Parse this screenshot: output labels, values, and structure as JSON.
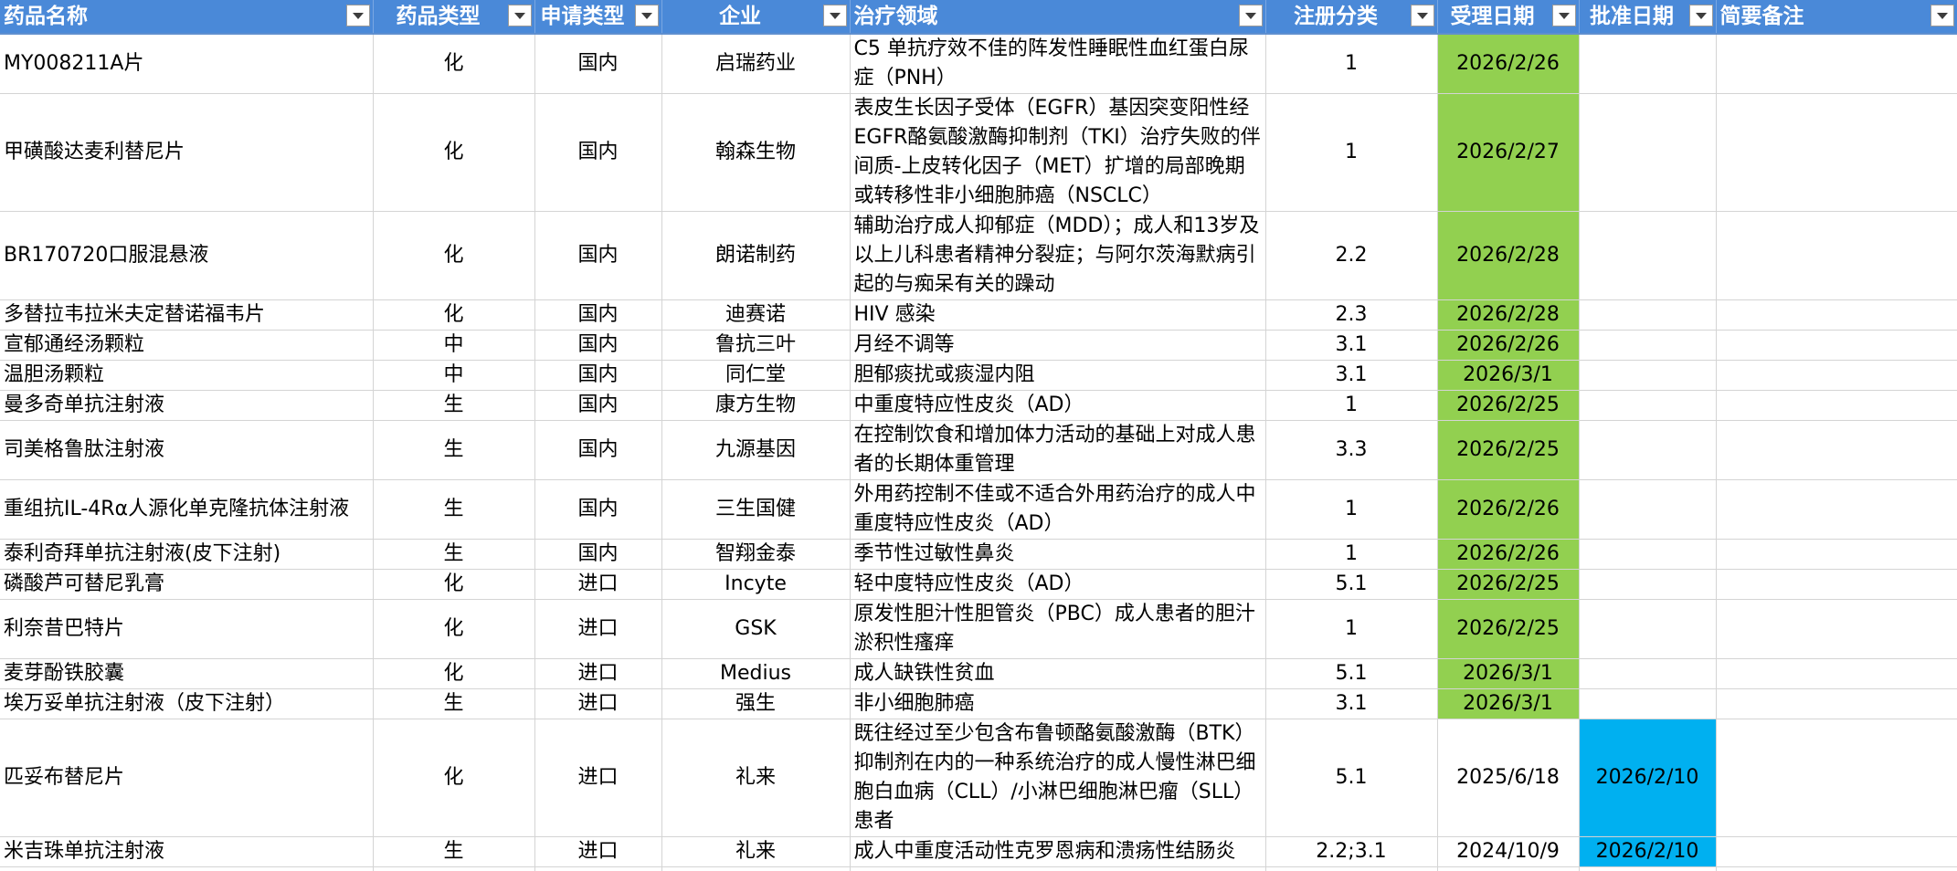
{
  "headers": [
    {
      "label": "药品名称",
      "align": "left"
    },
    {
      "label": "药品类型",
      "align": "center"
    },
    {
      "label": "申请类型",
      "align": "center"
    },
    {
      "label": "企业",
      "align": "center"
    },
    {
      "label": "治疗领域",
      "align": "left"
    },
    {
      "label": "注册分类",
      "align": "center"
    },
    {
      "label": "受理日期",
      "align": "center"
    },
    {
      "label": "批准日期",
      "align": "center"
    },
    {
      "label": "简要备注",
      "align": "left"
    }
  ],
  "filter_icon": "dropdown-arrow",
  "colors": {
    "header_bg": "#4a89d8",
    "accepted_highlight": "#92d050",
    "approved_highlight": "#00b0f0",
    "gridline": "#d4d4d4"
  },
  "rows": [
    {
      "name": "MY008211A片",
      "type": "化",
      "app": "国内",
      "company": "启瑞药业",
      "area": "C5 单抗疗效不佳的阵发性睡眠性血红蛋白尿症（PNH）",
      "cls": "1",
      "accept": "2026/2/26",
      "approve": "",
      "note": "",
      "accept_hl": true,
      "approve_hl": false
    },
    {
      "name": "甲磺酸达麦利替尼片",
      "type": "化",
      "app": "国内",
      "company": "翰森生物",
      "area": "表皮生长因子受体（EGFR）基因突变阳性经EGFR酪氨酸激酶抑制剂（TKI）治疗失败的伴间质-上皮转化因子（MET）扩增的局部晚期或转移性非小细胞肺癌（NSCLC）",
      "cls": "1",
      "accept": "2026/2/27",
      "approve": "",
      "note": "",
      "accept_hl": true,
      "approve_hl": false
    },
    {
      "name": "BR170720口服混悬液",
      "type": "化",
      "app": "国内",
      "company": "朗诺制药",
      "area": "辅助治疗成人抑郁症（MDD）；成人和13岁及以上儿科患者精神分裂症；与阿尔茨海默病引起的与痴呆有关的躁动",
      "cls": "2.2",
      "accept": "2026/2/28",
      "approve": "",
      "note": "",
      "accept_hl": true,
      "approve_hl": false
    },
    {
      "name": "多替拉韦拉米夫定替诺福韦片",
      "type": "化",
      "app": "国内",
      "company": "迪赛诺",
      "area": "HIV 感染",
      "cls": "2.3",
      "accept": "2026/2/28",
      "approve": "",
      "note": "",
      "accept_hl": true,
      "approve_hl": false
    },
    {
      "name": "宣郁通经汤颗粒",
      "type": "中",
      "app": "国内",
      "company": "鲁抗三叶",
      "area": "月经不调等",
      "cls": "3.1",
      "accept": "2026/2/26",
      "approve": "",
      "note": "",
      "accept_hl": true,
      "approve_hl": false
    },
    {
      "name": "温胆汤颗粒",
      "type": "中",
      "app": "国内",
      "company": "同仁堂",
      "area": "胆郁痰扰或痰湿内阻",
      "cls": "3.1",
      "accept": "2026/3/1",
      "approve": "",
      "note": "",
      "accept_hl": true,
      "approve_hl": false
    },
    {
      "name": "曼多奇单抗注射液",
      "type": "生",
      "app": "国内",
      "company": "康方生物",
      "area": "中重度特应性皮炎（AD）",
      "cls": "1",
      "accept": "2026/2/25",
      "approve": "",
      "note": "",
      "accept_hl": true,
      "approve_hl": false
    },
    {
      "name": "司美格鲁肽注射液",
      "type": "生",
      "app": "国内",
      "company": "九源基因",
      "area": "在控制饮食和增加体力活动的基础上对成人患者的长期体重管理",
      "cls": "3.3",
      "accept": "2026/2/25",
      "approve": "",
      "note": "",
      "accept_hl": true,
      "approve_hl": false
    },
    {
      "name": "重组抗IL-4Rα人源化单克隆抗体注射液",
      "type": "生",
      "app": "国内",
      "company": "三生国健",
      "area": "外用药控制不佳或不适合外用药治疗的成人中重度特应性皮炎（AD）",
      "cls": "1",
      "accept": "2026/2/26",
      "approve": "",
      "note": "",
      "accept_hl": true,
      "approve_hl": false
    },
    {
      "name": "泰利奇拜单抗注射液(皮下注射)",
      "type": "生",
      "app": "国内",
      "company": "智翔金泰",
      "area": "季节性过敏性鼻炎",
      "cls": "1",
      "accept": "2026/2/26",
      "approve": "",
      "note": "",
      "accept_hl": true,
      "approve_hl": false
    },
    {
      "name": "磷酸芦可替尼乳膏",
      "type": "化",
      "app": "进口",
      "company": "Incyte",
      "area": "轻中度特应性皮炎（AD）",
      "cls": "5.1",
      "accept": "2026/2/25",
      "approve": "",
      "note": "",
      "accept_hl": true,
      "approve_hl": false
    },
    {
      "name": "利奈昔巴特片",
      "type": "化",
      "app": "进口",
      "company": "GSK",
      "area": "原发性胆汁性胆管炎（PBC）成人患者的胆汁淤积性瘙痒",
      "cls": "1",
      "accept": "2026/2/25",
      "approve": "",
      "note": "",
      "accept_hl": true,
      "approve_hl": false
    },
    {
      "name": "麦芽酚铁胶囊",
      "type": "化",
      "app": "进口",
      "company": "Medius",
      "area": "成人缺铁性贫血",
      "cls": "5.1",
      "accept": "2026/3/1",
      "approve": "",
      "note": "",
      "accept_hl": true,
      "approve_hl": false
    },
    {
      "name": "埃万妥单抗注射液（皮下注射）",
      "type": "生",
      "app": "进口",
      "company": "强生",
      "area": "非小细胞肺癌",
      "cls": "3.1",
      "accept": "2026/3/1",
      "approve": "",
      "note": "",
      "accept_hl": true,
      "approve_hl": false
    },
    {
      "name": "匹妥布替尼片",
      "type": "化",
      "app": "进口",
      "company": "礼来",
      "area": "既往经过至少包含布鲁顿酪氨酸激酶（BTK）抑制剂在内的一种系统治疗的成人慢性淋巴细胞白血病（CLL）/小淋巴细胞淋巴瘤（SLL）患者",
      "cls": "5.1",
      "accept": "2025/6/18",
      "approve": "2026/2/10",
      "note": "",
      "accept_hl": false,
      "approve_hl": true
    },
    {
      "name": "米吉珠单抗注射液",
      "type": "生",
      "app": "进口",
      "company": "礼来",
      "area": "成人中重度活动性克罗恩病和溃疡性结肠炎",
      "cls": "2.2;3.1",
      "accept": "2024/10/9",
      "approve": "2026/2/10",
      "note": "",
      "accept_hl": false,
      "approve_hl": true
    }
  ]
}
